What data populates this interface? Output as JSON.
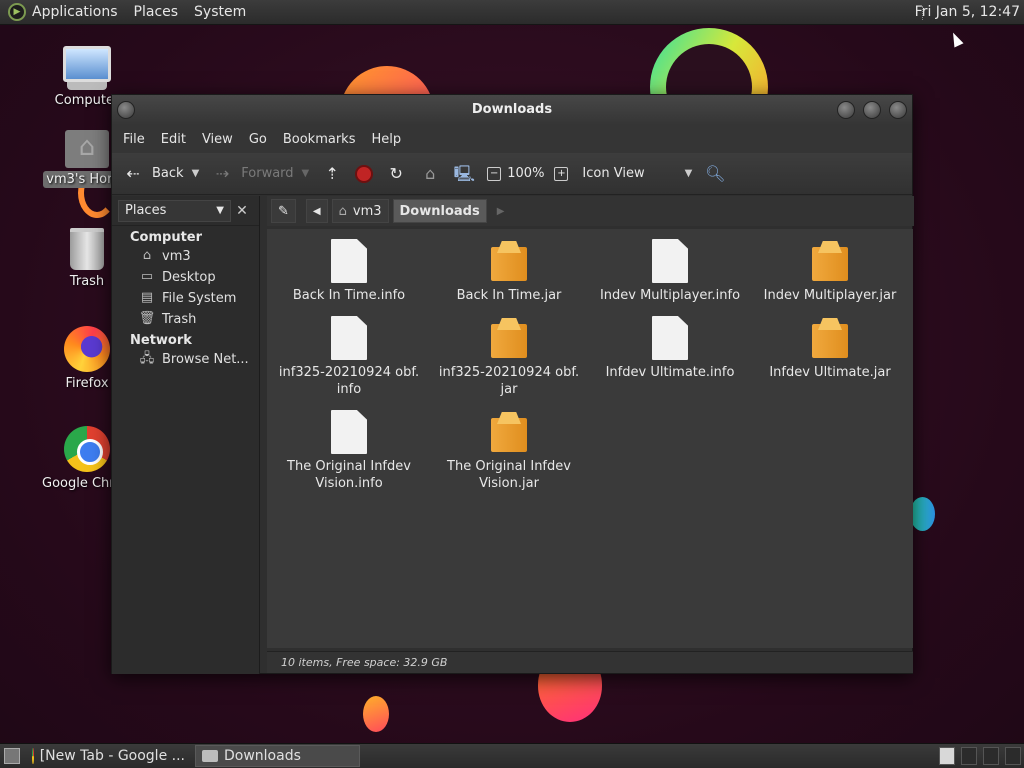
{
  "top_panel": {
    "menus": [
      "Applications",
      "Places",
      "System"
    ],
    "clock": "Fri Jan  5, 12:47"
  },
  "desktop_icons": [
    {
      "label": "Computer",
      "icon": "computer-icon"
    },
    {
      "label": "vm3's Home",
      "icon": "home-folder-icon"
    },
    {
      "label": "Trash",
      "icon": "trash-icon"
    },
    {
      "label": "Firefox",
      "icon": "firefox-icon"
    },
    {
      "label": "Google Chrome",
      "icon": "chrome-icon"
    }
  ],
  "window": {
    "title": "Downloads",
    "menu": [
      "File",
      "Edit",
      "View",
      "Go",
      "Bookmarks",
      "Help"
    ],
    "toolbar": {
      "back": "Back",
      "forward": "Forward",
      "zoom": "100%",
      "view_mode": "Icon View"
    },
    "sidebar": {
      "selector": "Places",
      "groups": [
        {
          "name": "Computer",
          "items": [
            {
              "label": "vm3",
              "icon": "home-icon"
            },
            {
              "label": "Desktop",
              "icon": "desktop-icon"
            },
            {
              "label": "File System",
              "icon": "drive-icon"
            },
            {
              "label": "Trash",
              "icon": "trash-icon"
            }
          ]
        },
        {
          "name": "Network",
          "items": [
            {
              "label": "Browse Net...",
              "icon": "network-icon"
            }
          ]
        }
      ]
    },
    "location": {
      "crumbs": [
        "vm3",
        "Downloads"
      ]
    },
    "files": [
      {
        "name": "Back In Time.info",
        "type": "document"
      },
      {
        "name": "Back In Time.jar",
        "type": "archive"
      },
      {
        "name": "Indev Multiplayer.info",
        "type": "document"
      },
      {
        "name": "Indev Multiplayer.jar",
        "type": "archive"
      },
      {
        "name": "inf325-20210924 obf.",
        "name2": "info",
        "type": "document"
      },
      {
        "name": "inf325-20210924 obf.",
        "name2": "jar",
        "type": "archive"
      },
      {
        "name": "Infdev Ultimate.info",
        "type": "document"
      },
      {
        "name": "Infdev Ultimate.jar",
        "type": "archive"
      },
      {
        "name": "The Original Infdev",
        "name2": "Vision.info",
        "type": "document"
      },
      {
        "name": "The Original Infdev",
        "name2": "Vision.jar",
        "type": "archive"
      }
    ],
    "status": "10 items, Free space: 32.9 GB"
  },
  "bottom_panel": {
    "tasks": [
      {
        "label": "[New Tab - Google ...",
        "icon": "chrome-icon"
      },
      {
        "label": "Downloads",
        "icon": "folder-icon"
      }
    ]
  }
}
